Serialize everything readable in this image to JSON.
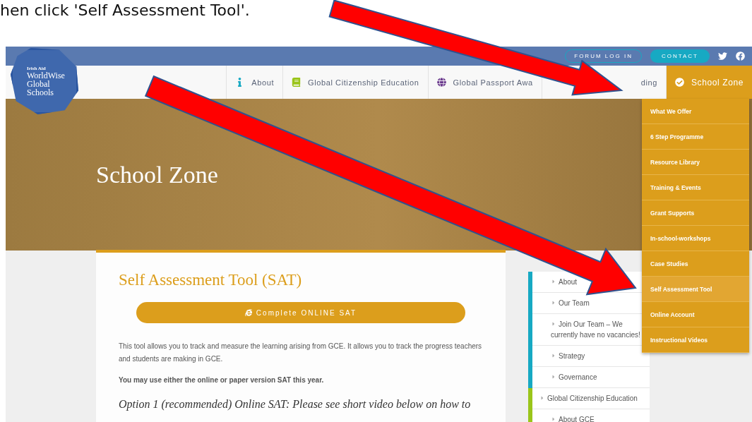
{
  "slide_caption": "hen click 'Self Assessment Tool'.",
  "top_bar": {
    "forum_login": "FORUM LOG IN",
    "contact": "CONTACT"
  },
  "logo": {
    "org": "Irish Aid",
    "name": "WorldWise Global Schools"
  },
  "nav": [
    {
      "kind": "info",
      "label": "About",
      "selected": false
    },
    {
      "kind": "book",
      "label": "Global Citizenship Education",
      "selected": false
    },
    {
      "kind": "globe",
      "label": "Global Passport Awa",
      "selected": false
    },
    {
      "kind": "plain",
      "label": "ding",
      "selected": false
    },
    {
      "kind": "check",
      "label": "School Zone",
      "selected": true
    }
  ],
  "hero": {
    "title": "School Zone"
  },
  "dropdown": [
    {
      "label": "What We Offer",
      "selected": false
    },
    {
      "label": "6 Step Programme",
      "selected": false
    },
    {
      "label": "Resource Library",
      "selected": false
    },
    {
      "label": "Training & Events",
      "selected": false
    },
    {
      "label": "Grant Supports",
      "selected": false
    },
    {
      "label": "In-school-workshops",
      "selected": false
    },
    {
      "label": "Case Studies",
      "selected": false
    },
    {
      "label": "Self Assessment Tool",
      "selected": true
    },
    {
      "label": "Online Account",
      "selected": false
    },
    {
      "label": "Instructional Videos",
      "selected": false
    }
  ],
  "content": {
    "title": "Self Assessment Tool (SAT)",
    "button": "Complete ONLINE SAT",
    "paragraph": "This tool allows you to track and measure the learning arising from GCE. It allows you to track the progress teachers and students are making in GCE.",
    "note": "You may use either the online or paper version SAT this year.",
    "subheading": "Option 1 (recommended) Online SAT: Please see short video below on how to"
  },
  "sidebar": [
    {
      "color": "#17a9c3",
      "children": [
        "About",
        "Our Team",
        "Join Our Team – We currently have no vacancies!",
        "Strategy",
        "Governance"
      ]
    },
    {
      "label": "Global Citizenship Education",
      "color": "#9ac51a",
      "children": [
        "About GCE"
      ]
    }
  ]
}
